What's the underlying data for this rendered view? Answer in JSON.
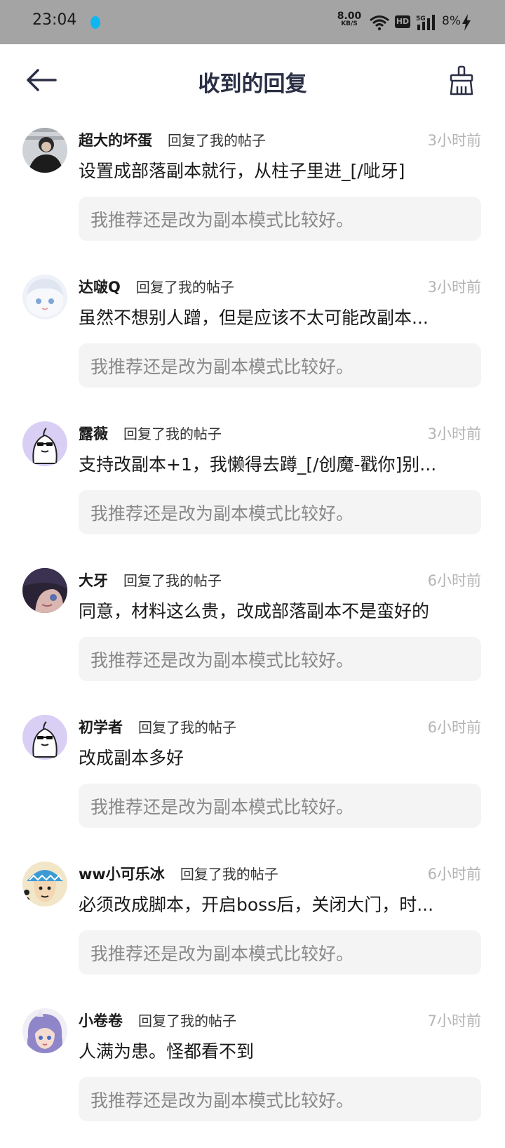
{
  "status_bar": {
    "time": "23:04",
    "net_speed_value": "8.00",
    "net_speed_unit": "KB/S",
    "hd": "HD",
    "network": "5G",
    "battery": "8%"
  },
  "header": {
    "title": "收到的回复",
    "back_icon": "arrow-left-icon",
    "clean_icon": "broom-icon"
  },
  "replies": [
    {
      "user": "超大的坏蛋",
      "action": "回复了我的帖子",
      "time": "3小时前",
      "content": "设置成部落副本就行，从柱子里进_[/呲牙]",
      "quote": "我推荐还是改为副本模式比较好。"
    },
    {
      "user": "达啵Q",
      "action": "回复了我的帖子",
      "time": "3小时前",
      "content": "虽然不想别人蹭，但是应该不太可能改副本...",
      "quote": "我推荐还是改为副本模式比较好。"
    },
    {
      "user": "露薇",
      "action": "回复了我的帖子",
      "time": "3小时前",
      "content": "支持改副本+1，我懒得去蹲_[/创魔-戳你]别...",
      "quote": "我推荐还是改为副本模式比较好。"
    },
    {
      "user": "大牙",
      "action": "回复了我的帖子",
      "time": "6小时前",
      "content": "同意，材料这么贵，改成部落副本不是蛮好的",
      "quote": "我推荐还是改为副本模式比较好。"
    },
    {
      "user": "初学者",
      "action": "回复了我的帖子",
      "time": "6小时前",
      "content": "改成副本多好",
      "quote": "我推荐还是改为副本模式比较好。"
    },
    {
      "user": "ww小可乐冰",
      "action": "回复了我的帖子",
      "time": "6小时前",
      "content": "必须改成脚本，开启boss后，关闭大门，时...",
      "quote": "我推荐还是改为副本模式比较好。"
    },
    {
      "user": "小卷卷",
      "action": "回复了我的帖子",
      "time": "7小时前",
      "content": "人满为患。怪都看不到",
      "quote": "我推荐还是改为副本模式比较好。"
    }
  ]
}
